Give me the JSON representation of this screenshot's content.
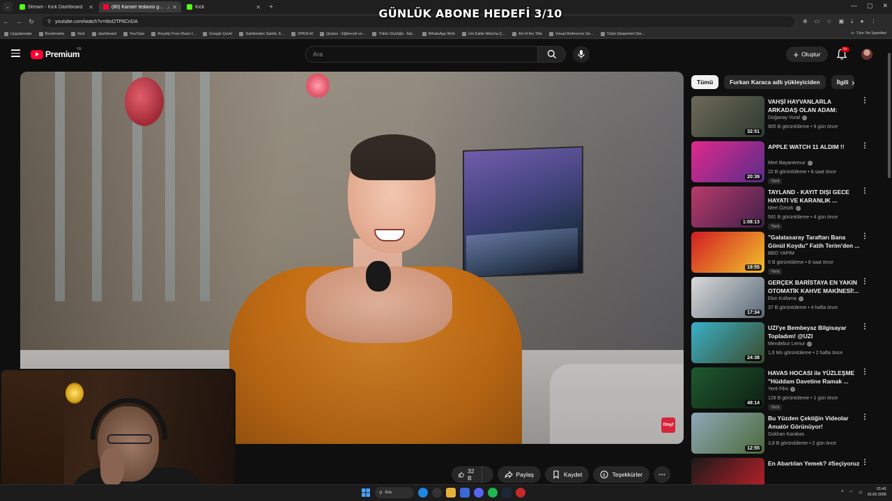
{
  "overlay": {
    "goal_text": "GÜNLÜK ABONE HEDEFİ 3/10"
  },
  "browser": {
    "tabs": [
      {
        "label": "Stream - Kick Dashboard",
        "favicon": "kick-icon"
      },
      {
        "label": "(80) Kanser tedavisi görüyo",
        "favicon": "youtube-icon"
      },
      {
        "label": "Kick",
        "favicon": "kick-icon"
      }
    ],
    "url": "youtube.com/watch?v=I8oOTP8CnDA",
    "bookmarks": [
      "Uygulamalar",
      "Bookmarks",
      "Kick",
      "dashboard",
      "YouTube",
      "Royalty Free Music f...",
      "Google Çeviri",
      "Sahibinden Satılık, K...",
      "OPEN AI",
      "Quizez - Eğlenceli ve...",
      "Tütün Sözlüğü - İtal...",
      "WhatsApp Web",
      "Üst Kalite Matcha Ç...",
      "Art of the Title",
      "Visual Reference Se...",
      "Tütün Eksperleri Der..."
    ],
    "bookmarks_all": "Tüm Yer İşaretleri"
  },
  "youtube": {
    "logo": "Premium",
    "logo_region": "TR",
    "search_placeholder": "Ara",
    "create_label": "Oluştur",
    "notif_count": "9+",
    "video_watermark": "fitnyf",
    "actions": {
      "likes": "32 B",
      "share": "Paylaş",
      "save": "Kaydet",
      "thanks": "Teşekkürler"
    },
    "chips": [
      "Tümü",
      "Furkan Karaca adlı yükleyiciden",
      "İlgili"
    ],
    "recommendations": [
      {
        "title": "VAHŞİ HAYVANLARLA ARKADAŞ OLAN ADAM: ÇOBA...",
        "channel": "Doğanay Vural",
        "verified": true,
        "meta": "905 B görüntüleme • 9 gün önce",
        "duration": "32:51",
        "new": "",
        "c1": "#6e6a5a",
        "c2": "#2d3a2e"
      },
      {
        "title": "APPLE WATCH 11 ALDIM !!",
        "channel": "Mert Bayantemur",
        "verified": true,
        "meta": "22 B görüntüleme • 8 saat önce",
        "duration": "20:39",
        "new": "Yeni",
        "c1": "#e02a8c",
        "c2": "#5a2c8a"
      },
      {
        "title": "TAYLAND - KAYIT DIŞI GECE HAYATI VE KARANLIK ...",
        "channel": "Mert Öztürk",
        "verified": true,
        "meta": "591 B görüntüleme • 4 gün önce",
        "duration": "1:08:13",
        "new": "Yeni",
        "c1": "#b83b6a",
        "c2": "#40204a"
      },
      {
        "title": "\"Galatasaray Taraftarı Bana Gönül Koydu\" Fatih Terim'den ...",
        "channel": "BBO YAPIM",
        "verified": false,
        "meta": "5 B görüntüleme • 8 saat önce",
        "duration": "19:55",
        "new": "Yeni",
        "c1": "#d11c24",
        "c2": "#f3c12c"
      },
      {
        "title": "GERÇEK BARİSTAYA EN YAKIN OTOMATİK KAHVE MAKİNESİ!...",
        "channel": "Ekin Kollama",
        "verified": true,
        "meta": "37 B görüntüleme • 4 hafta önce",
        "duration": "17:34",
        "new": "",
        "c1": "#dadada",
        "c2": "#5a6a78"
      },
      {
        "title": "UZI'ye Bembeyaz Bilgisayar Topladım! @UZI",
        "channel": "Mendebur Lemur",
        "verified": true,
        "meta": "1,6 Mn görüntüleme • 2 hafta önce",
        "duration": "24:38",
        "new": "",
        "c1": "#39b0c8",
        "c2": "#3b4b2a"
      },
      {
        "title": "HAVAS HOCASI ile YÜZLEŞME \"Hüddam Davetine Ramak ...",
        "channel": "Yer6 Film",
        "verified": true,
        "meta": "128 B görüntüleme • 1 gün önce",
        "duration": "48:14",
        "new": "Yeni",
        "c1": "#1e5a2e",
        "c2": "#0e1e12"
      },
      {
        "title": "Bu Yüzden Çektiğin Videolar Amatör Görünüyor!",
        "channel": "Gokhan Karakas",
        "verified": false,
        "meta": "3,8 B görüntüleme • 2 gün önce",
        "duration": "12:55",
        "new": "",
        "c1": "#8fa8b8",
        "c2": "#4b6a3a"
      },
      {
        "title": "En Abartılan Yemek? #Seçiyoruz",
        "channel": "",
        "verified": false,
        "meta": "",
        "duration": "",
        "new": "",
        "c1": "#1a1a1a",
        "c2": "#c8202a"
      }
    ]
  },
  "taskbar": {
    "search_label": "Ara",
    "time": "01:41",
    "date": "16.02.2026"
  }
}
